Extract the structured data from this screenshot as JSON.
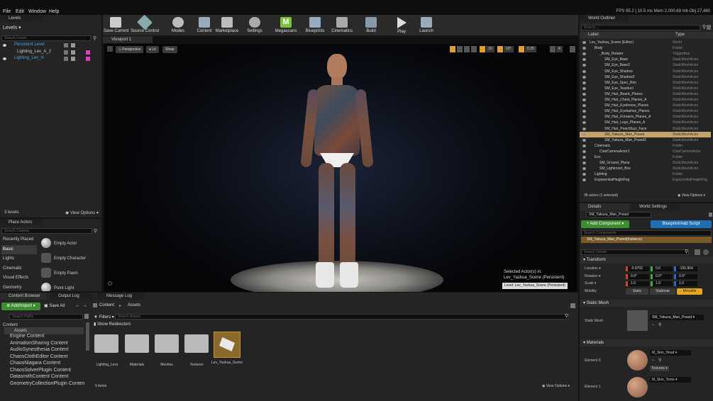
{
  "menu": {
    "items": [
      "File",
      "Edit",
      "Window",
      "Help"
    ],
    "stats": "FPS 95.2 | 10.5 ms  Mem 2,000.69 mb  Obj 27,480"
  },
  "levels": {
    "tab": "Levels",
    "header": "Levels",
    "search_placeholder": "Search Levels",
    "items": [
      "Persistent Level",
      "Lighting_Lev_A_2",
      "Lighting_Lev_H"
    ],
    "count": "3 levels",
    "view_options": "View Options"
  },
  "place_actors": {
    "tab": "Place Actors",
    "search_placeholder": "Search Classes",
    "categories": [
      "Recently Placed",
      "Basic",
      "Lights",
      "Cinematic",
      "Visual Effects",
      "Geometry"
    ],
    "actors": [
      "Empty Actor",
      "Empty Character",
      "Empty Pawn",
      "Point Light"
    ]
  },
  "toolbar": {
    "buttons": [
      "Save Current",
      "Source Control",
      "Modes",
      "Content",
      "Marketplace",
      "Settings",
      "Megascans",
      "Blueprints",
      "Cinematics",
      "Build",
      "Play",
      "Launch"
    ],
    "megascans_icon": "M"
  },
  "viewport": {
    "tab": "Viewport 1",
    "perspective": "Perspective",
    "lit": "Lit",
    "show": "Show",
    "snap_value1": "10",
    "snap_value2": "10°",
    "snap_value3": "0.25",
    "camera_speed": "4",
    "selected_line1": "Selected Actor(s) in:",
    "selected_line2": "Lev_Yazkua_Scene (Persistent)",
    "level_label": "Level:  Lev_Yazkua_Scene (Persistent)"
  },
  "outliner": {
    "tab": "World Outliner",
    "search_placeholder": "Search...",
    "col_label": "Label",
    "col_type": "Type",
    "count": "38 actors (1 selected)",
    "view_options": "View Options",
    "rows": [
      {
        "name": "Lev_Yazkua_Scene (Editor)",
        "type": "World",
        "indent": 0,
        "sel": false
      },
      {
        "name": "Body",
        "type": "Folder",
        "indent": 1,
        "sel": false
      },
      {
        "name": "_Body_Rotator",
        "type": "TriggerBox",
        "indent": 2,
        "sel": false
      },
      {
        "name": "SM_Eye_Base",
        "type": "StaticMeshActor",
        "indent": 3,
        "sel": false
      },
      {
        "name": "SM_Eye_Base2",
        "type": "StaticMeshActor",
        "indent": 3,
        "sel": false
      },
      {
        "name": "SM_Eye_Shadow",
        "type": "StaticMeshActor",
        "indent": 3,
        "sel": false
      },
      {
        "name": "SM_Eye_Shadow2",
        "type": "StaticMeshActor",
        "indent": 3,
        "sel": false
      },
      {
        "name": "SM_Eye_Spec_Rim",
        "type": "StaticMeshActor",
        "indent": 3,
        "sel": false
      },
      {
        "name": "SM_Eye_Tearduct",
        "type": "StaticMeshActor",
        "indent": 3,
        "sel": false
      },
      {
        "name": "SM_Hair_Beard_Planes",
        "type": "StaticMeshActor",
        "indent": 3,
        "sel": false
      },
      {
        "name": "SM_Hair_Chest_Planes_A",
        "type": "StaticMeshActor",
        "indent": 3,
        "sel": false
      },
      {
        "name": "SM_Hair_Eyebrows_Planes",
        "type": "StaticMeshActor",
        "indent": 3,
        "sel": false
      },
      {
        "name": "SM_Hair_Eyelashes_Planes",
        "type": "StaticMeshActor",
        "indent": 3,
        "sel": false
      },
      {
        "name": "SM_Hair_Forearm_Planes_A",
        "type": "StaticMeshActor",
        "indent": 3,
        "sel": false
      },
      {
        "name": "SM_Hair_Legs_Planes_A",
        "type": "StaticMeshActor",
        "indent": 3,
        "sel": false
      },
      {
        "name": "SM_Hair_Peachfuzz_Face",
        "type": "StaticMeshActor",
        "indent": 3,
        "sel": false
      },
      {
        "name": "SM_Yakuza_Man_Posed",
        "type": "StaticMeshActor",
        "indent": 3,
        "sel": true
      },
      {
        "name": "SM_Yakuza_Man_Posed2",
        "type": "StaticMeshActor",
        "indent": 3,
        "sel": false
      },
      {
        "name": "Cinematic",
        "type": "Folder",
        "indent": 1,
        "sel": false
      },
      {
        "name": "CineCameraActor1",
        "type": "CineCameraActor",
        "indent": 2,
        "sel": false
      },
      {
        "name": "Env",
        "type": "Folder",
        "indent": 1,
        "sel": false
      },
      {
        "name": "SM_Ground_Plane",
        "type": "StaticMeshActor",
        "indent": 2,
        "sel": false
      },
      {
        "name": "SM_Lightroom_Box",
        "type": "StaticMeshActor",
        "indent": 2,
        "sel": false
      },
      {
        "name": "Lighting",
        "type": "Folder",
        "indent": 1,
        "sel": false
      },
      {
        "name": "ExponentialHeightFog",
        "type": "ExponentialHeightFog",
        "indent": 1,
        "sel": false
      }
    ]
  },
  "details": {
    "tab_details": "Details",
    "tab_world": "World Settings",
    "name_value": "SM_Yakuza_Man_Posed",
    "add_component": "+ Add Component",
    "blueprint_script": "Blueprint/Add Script",
    "search_components": "Search Components",
    "instance": "SM_Yakuza_Man_Posed(Instance)",
    "search_details": "Search Details",
    "transform": "Transform",
    "location_label": "Location",
    "rotation_label": "Rotation",
    "scale_label": "Scale",
    "mobility_label": "Mobility",
    "location": [
      "-0.9702",
      "0.0",
      "-155.964"
    ],
    "rotation": [
      "0.0°",
      "0.0°",
      "0.0°"
    ],
    "scale": [
      "1.0",
      "1.0",
      "1.0"
    ],
    "mobility": [
      "Static",
      "Stationar",
      "Movable"
    ],
    "static_mesh_section": "Static Mesh",
    "static_mesh_label": "Static Mesh",
    "static_mesh_value": "SM_Yakuza_Man_Posed",
    "materials_section": "Materials",
    "element0": "Element 0",
    "element1": "Element 1",
    "mat0": "M_Skin_Head",
    "mat1": "M_Skin_Torso",
    "textures": "Textures"
  },
  "content_browser": {
    "tab": "Content Browser",
    "tab_log": "Output Log",
    "tab_msg": "Message Log",
    "add_import": "Add/Import",
    "save_all": "Save All",
    "path1": "Content",
    "path2": "Assets",
    "search_paths": "Search Paths",
    "filters": "Filters",
    "search_assets": "Search Assets",
    "show_redirectors": "Show Redirectors",
    "tree": [
      "Content",
      "Assets",
      "Engine Content",
      "AnimationSharing Content",
      "AudioSynesthesia Content",
      "ChaosClothEditor Content",
      "ChaosNiagara Content",
      "ChaosSolverPlugin Content",
      "DatasmithContent Content",
      "GeometryCollectionPlugin Conten"
    ],
    "folders": [
      "Lighting_Levs",
      "Materials",
      "Meshes",
      "Textures"
    ],
    "asset": "Lev_Yazkua_Scene",
    "count": "5 items",
    "view_options": "View Options"
  }
}
